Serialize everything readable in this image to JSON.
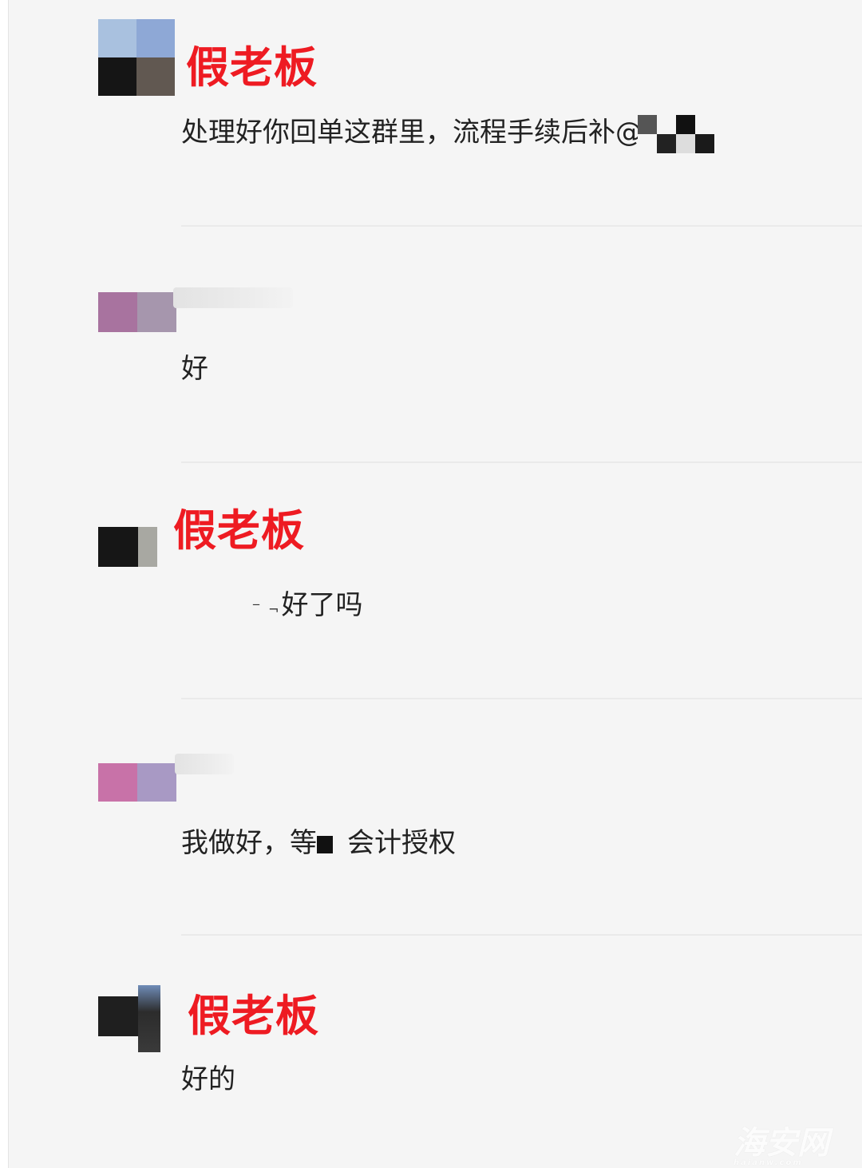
{
  "messages": [
    {
      "sender": "假老板",
      "text": "处理好你回单这群里，流程手续后补@"
    },
    {
      "sender": "",
      "text": "好"
    },
    {
      "sender": "假老板",
      "text": "好了吗",
      "text_prefix": "-,-,",
      "prefix_hidden": true
    },
    {
      "sender": "",
      "text_a": "我做好，等",
      "text_b": "会计授权"
    },
    {
      "sender": "假老板",
      "text": "好的"
    }
  ],
  "watermark": {
    "main": "海安网",
    "sub": "haianw.com"
  },
  "colors": {
    "sender_red": "#ee1b22",
    "background": "#f5f5f5",
    "divider": "#eaeaea"
  }
}
